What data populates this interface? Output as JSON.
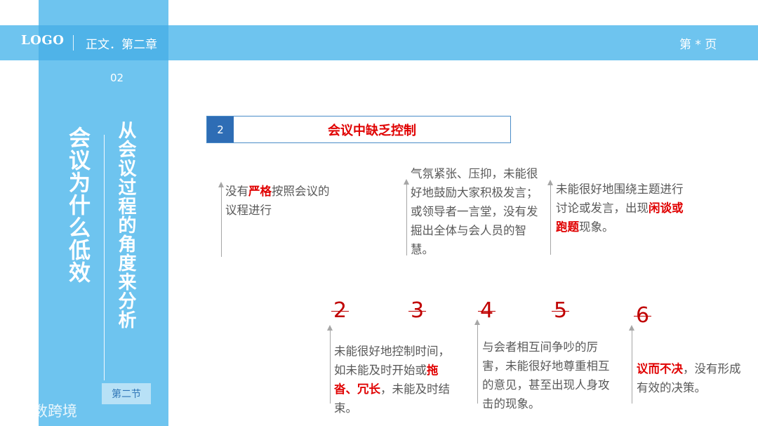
{
  "header": {
    "logo": "LOGO",
    "chapter": "正文．第二章",
    "page": "第 * 页"
  },
  "sidebar": {
    "section_number": "02",
    "main_title": "会议为什么低效",
    "sub_title": "从会议过程的角度来分析",
    "section_badge": "第二节",
    "watermark": "大数跨境"
  },
  "heading": {
    "number": "2",
    "title": "会议中缺乏控制"
  },
  "items": [
    {
      "pre": "没有",
      "highlight": "严格",
      "post": "按照会议的议程进行"
    },
    {
      "pre": "气氛紧张、压抑，未能很好地鼓励大家积极发言；或领导者一言堂，没有发掘出全体与会人员的智慧。",
      "highlight": "",
      "post": ""
    },
    {
      "pre": "未能很好地围绕主题进行讨论或发言，出现",
      "highlight": "闲谈或跑题",
      "post": "现象。"
    },
    {
      "pre": "未能很好地控制时间，如未能及时开始或",
      "highlight": "拖沓、冗长",
      "post": "，未能及时结束。"
    },
    {
      "pre": "与会者相互间争吵的厉害，未能很好地尊重相互的意见，甚至出现人身攻击的现象。",
      "highlight": "",
      "post": ""
    },
    {
      "pre": "",
      "highlight": "议而不决",
      "post": "，没有形成有效的决策。"
    }
  ],
  "number_marks": [
    "2",
    "3",
    "4",
    "5",
    "6"
  ],
  "colors": {
    "band": "#6ec4ef",
    "accent_blue": "#2e6db5",
    "highlight_red": "#e00000"
  }
}
